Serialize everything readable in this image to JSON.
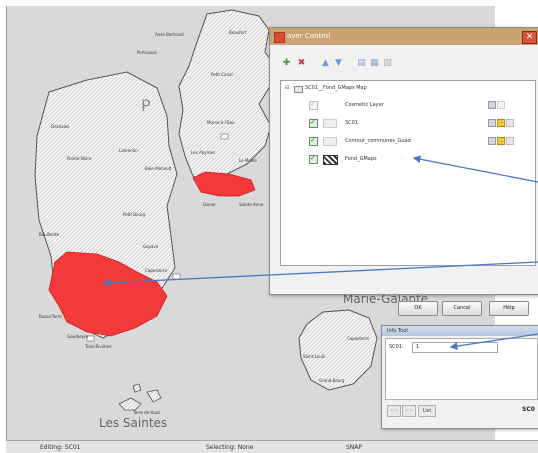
{
  "layer_control": {
    "title": "ayer Control",
    "root_layer": "SC01__Fond_GMaps Map",
    "layers": [
      {
        "label": "Cosmetic Layer",
        "checked": true,
        "dim": true
      },
      {
        "label": "SC01",
        "checked": true,
        "dim": false
      },
      {
        "label": "Contour_communes_Guad",
        "checked": true,
        "dim": false
      },
      {
        "label": "Fond_GMaps",
        "checked": true,
        "dim": false
      }
    ],
    "buttons": {
      "ok": "OK",
      "cancel": "Cancel",
      "help": "Help"
    }
  },
  "info_tool": {
    "title": "Info Tool",
    "field_label": "SC01:",
    "field_value": "1",
    "nav_list": "List",
    "right_label": "SC0"
  },
  "map": {
    "labels": {
      "marie_galante": "Marie-Galante",
      "les_saintes": "Les Saintes",
      "p_letter": "P"
    },
    "places": [
      "Anse Bertrand",
      "Port-Louis",
      "Beaufort",
      "Petit Canal",
      "Morne-à-l'Eau",
      "Les Abymes",
      "Gosier",
      "Sainte-Anne",
      "Le Moule",
      "Lamentin",
      "Baie-Mahault",
      "Pointe-Noire",
      "Petit Bourg",
      "Goyave",
      "Capesterre",
      "Deshaies",
      "Bouillante",
      "Basse-Terre",
      "Trois-Rivières",
      "Grand Bourg",
      "Capesterre",
      "Saint-Louis",
      "Terre de Haut",
      "Gourbeyre"
    ],
    "highlight_color": "#f23a3a",
    "arrow_color": "#4a78c0"
  },
  "status_bar": {
    "editing": "Editing: SC01",
    "selecting": "Selecting: None",
    "snap": "SNAP"
  }
}
